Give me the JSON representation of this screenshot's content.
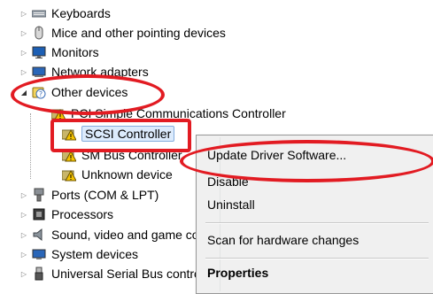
{
  "tree": {
    "items": [
      {
        "label": "Keyboards",
        "icon": "keyboard-icon",
        "expander": "collapsed"
      },
      {
        "label": "Mice and other pointing devices",
        "icon": "mouse-icon",
        "expander": "collapsed"
      },
      {
        "label": "Monitors",
        "icon": "monitor-icon",
        "expander": "collapsed"
      },
      {
        "label": "Network adapters",
        "icon": "network-adapter-icon",
        "expander": "collapsed"
      },
      {
        "label": "Other devices",
        "icon": "other-devices-icon",
        "expander": "expanded"
      },
      {
        "label": "PCI Simple Communications Controller",
        "icon": "warning-device-icon"
      },
      {
        "label": "SCSI Controller",
        "icon": "warning-device-icon",
        "selected": true
      },
      {
        "label": "SM Bus Controller",
        "icon": "warning-device-icon"
      },
      {
        "label": "Unknown device",
        "icon": "warning-device-icon"
      },
      {
        "label": "Ports (COM & LPT)",
        "icon": "port-icon",
        "expander": "collapsed"
      },
      {
        "label": "Processors",
        "icon": "processor-icon",
        "expander": "collapsed"
      },
      {
        "label": "Sound, video and game controllers",
        "icon": "sound-icon",
        "expander": "collapsed"
      },
      {
        "label": "System devices",
        "icon": "system-devices-icon",
        "expander": "collapsed"
      },
      {
        "label": "Universal Serial Bus controllers",
        "icon": "usb-icon",
        "expander": "collapsed"
      }
    ]
  },
  "context_menu": {
    "items": [
      {
        "label": "Update Driver Software...",
        "bold": false
      },
      {
        "label": "Disable",
        "bold": false
      },
      {
        "label": "Uninstall",
        "bold": false
      },
      {
        "label": "Scan for hardware changes",
        "bold": false
      },
      {
        "label": "Properties",
        "bold": true
      }
    ]
  },
  "colors": {
    "annotation": "#e21b22",
    "selection_bg": "#dcebfc",
    "selection_border": "#84acdd",
    "menu_bg": "#f0f0f0"
  }
}
